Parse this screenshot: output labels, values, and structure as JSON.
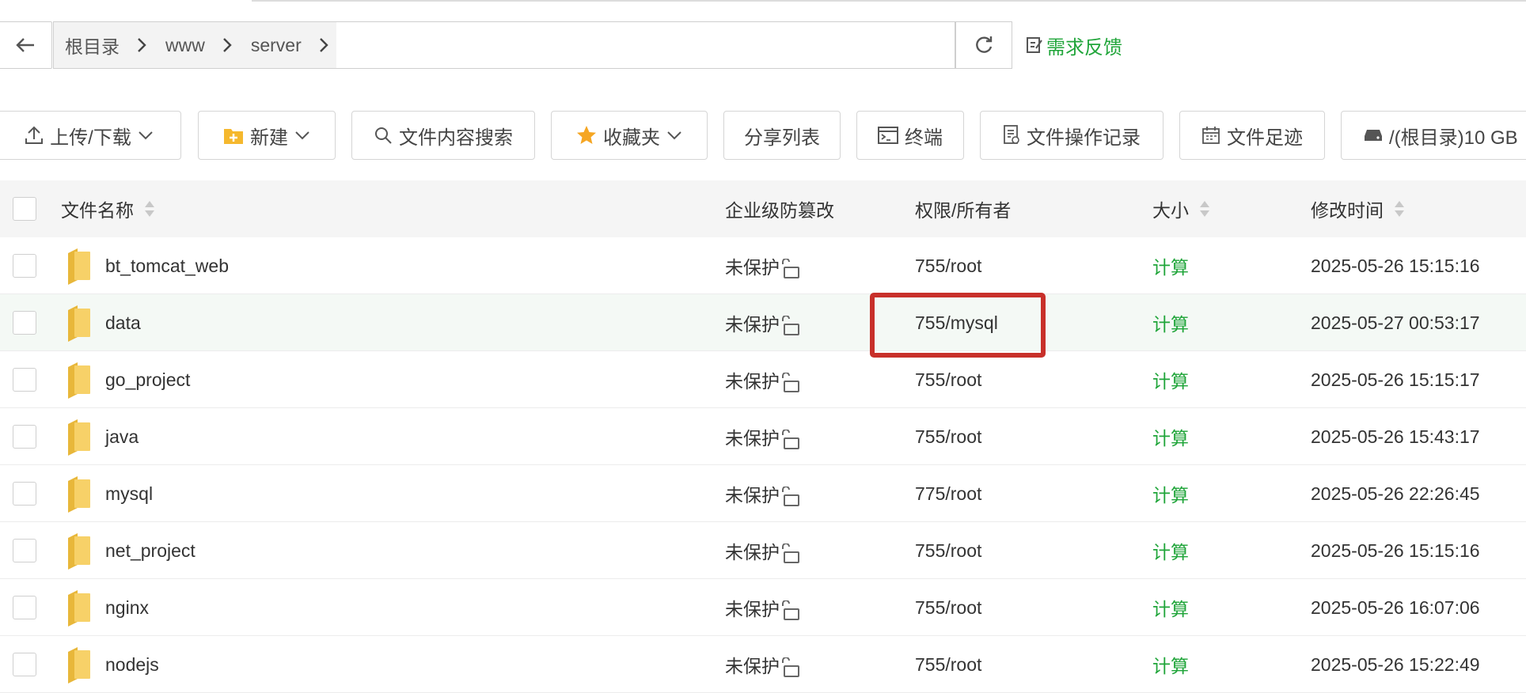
{
  "breadcrumbs": [
    {
      "label": "根目录"
    },
    {
      "label": "www"
    },
    {
      "label": "server"
    }
  ],
  "feedback_label": "需求反馈",
  "toolbar": {
    "upload": "上传/下载",
    "new": "新建",
    "search": "文件内容搜索",
    "favorites": "收藏夹",
    "share": "分享列表",
    "terminal": "终端",
    "oplog": "文件操作记录",
    "footprint": "文件足迹",
    "disk": "/(根目录)10 GB"
  },
  "columns": {
    "name": "文件名称",
    "protect": "企业级防篡改",
    "perm": "权限/所有者",
    "size": "大小",
    "mtime": "修改时间"
  },
  "rows": [
    {
      "name": "bt_tomcat_web",
      "protect": "未保护",
      "perm": "755/root",
      "size": "计算",
      "mtime": "2025-05-26 15:15:16"
    },
    {
      "name": "data",
      "protect": "未保护",
      "perm": "755/mysql",
      "size": "计算",
      "mtime": "2025-05-27 00:53:17"
    },
    {
      "name": "go_project",
      "protect": "未保护",
      "perm": "755/root",
      "size": "计算",
      "mtime": "2025-05-26 15:15:17"
    },
    {
      "name": "java",
      "protect": "未保护",
      "perm": "755/root",
      "size": "计算",
      "mtime": "2025-05-26 15:43:17"
    },
    {
      "name": "mysql",
      "protect": "未保护",
      "perm": "775/root",
      "size": "计算",
      "mtime": "2025-05-26 22:26:45"
    },
    {
      "name": "net_project",
      "protect": "未保护",
      "perm": "755/root",
      "size": "计算",
      "mtime": "2025-05-26 15:15:16"
    },
    {
      "name": "nginx",
      "protect": "未保护",
      "perm": "755/root",
      "size": "计算",
      "mtime": "2025-05-26 16:07:06"
    },
    {
      "name": "nodejs",
      "protect": "未保护",
      "perm": "755/root",
      "size": "计算",
      "mtime": "2025-05-26 15:22:49"
    }
  ],
  "colors": {
    "accent": "#20a53a",
    "highlight": "#c8302a",
    "folder": "#f5c84c"
  }
}
